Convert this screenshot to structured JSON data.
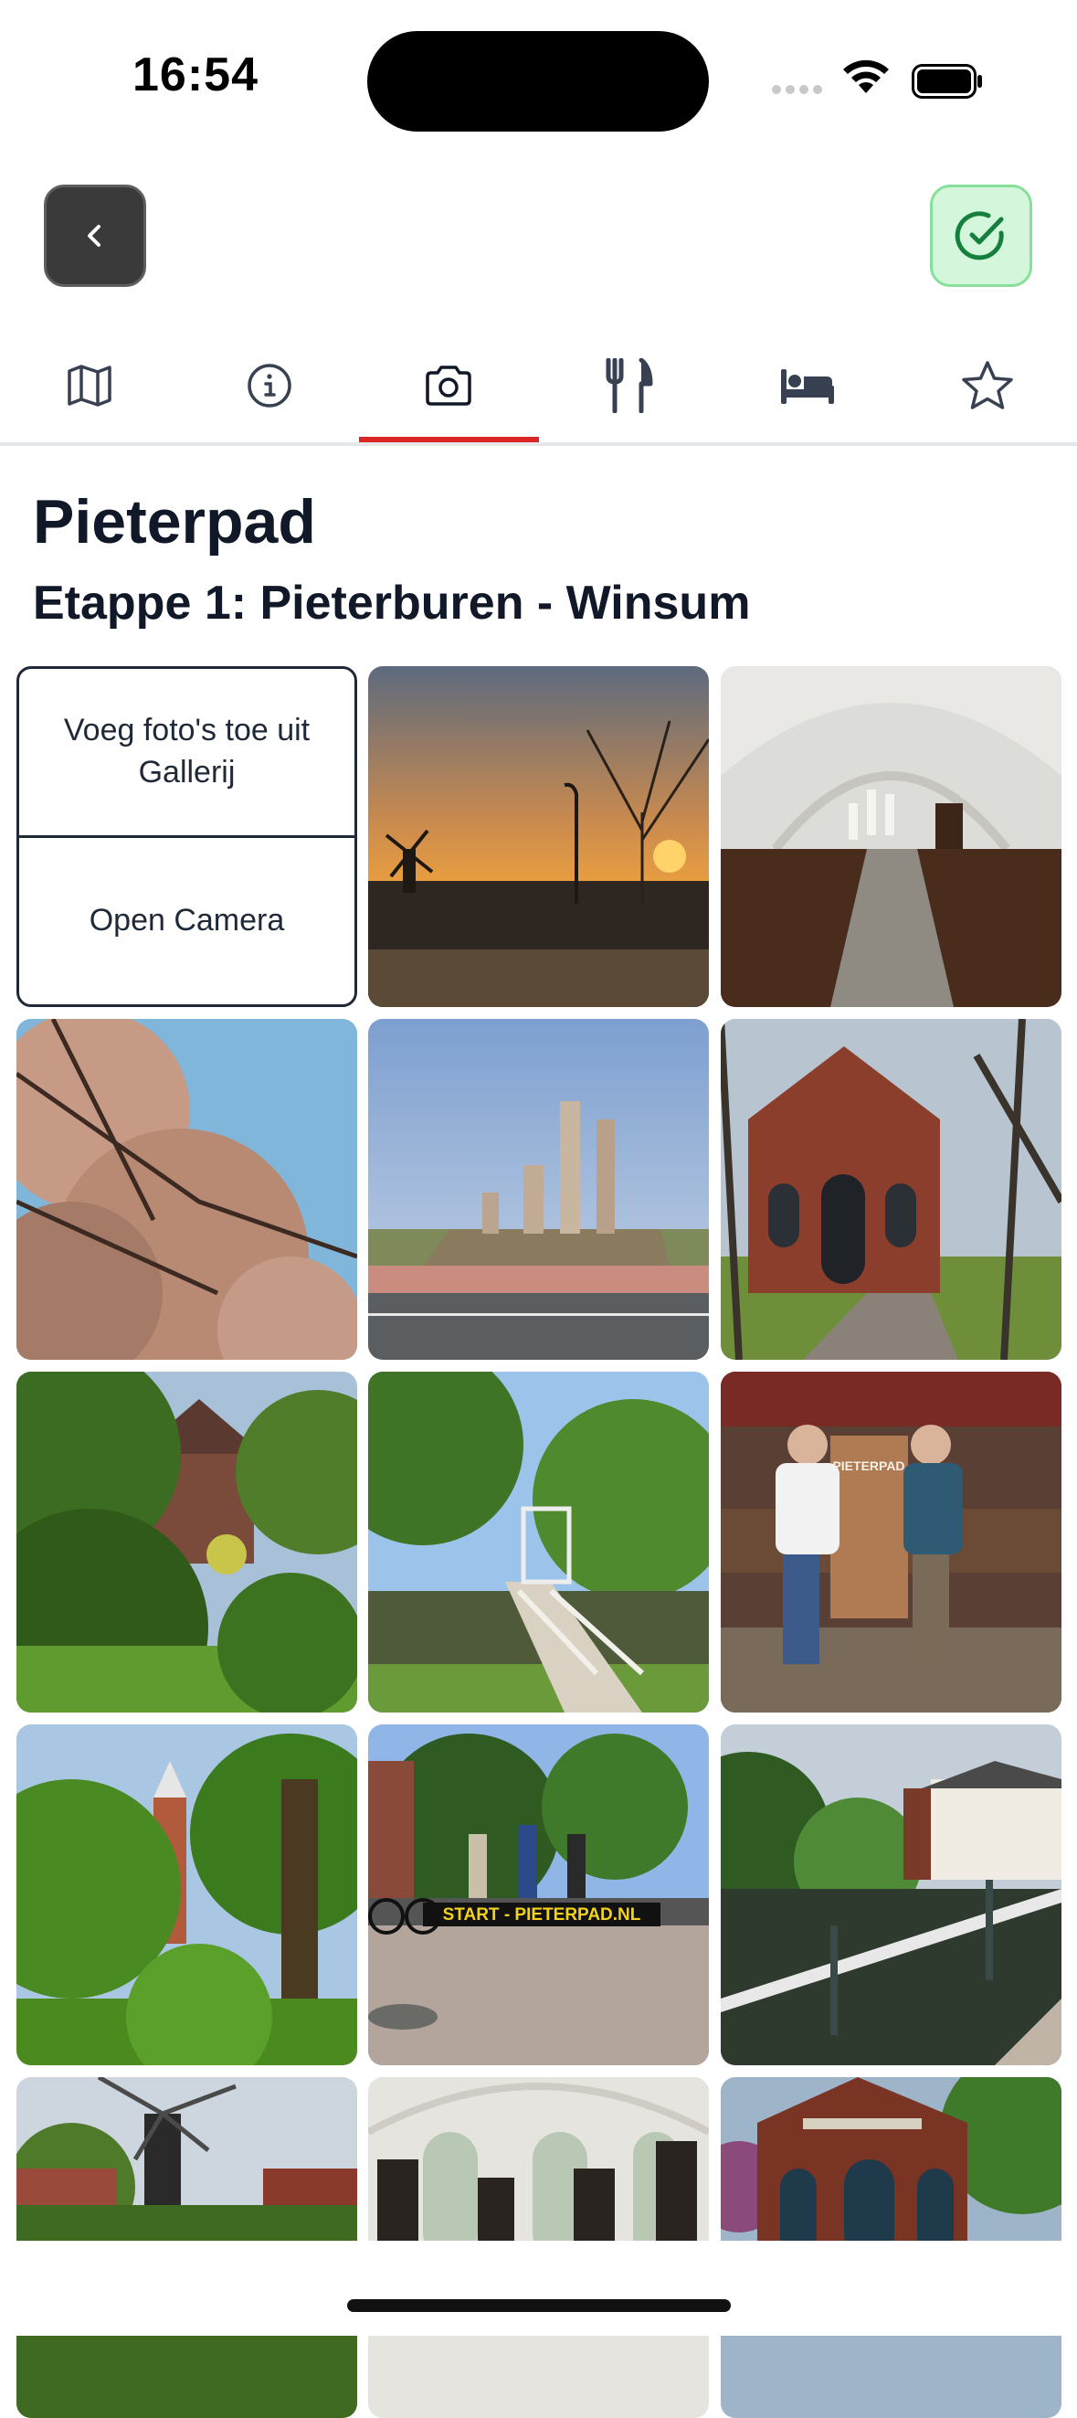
{
  "status_bar": {
    "time": "16:54"
  },
  "tabs": [
    {
      "name": "map-icon",
      "active": false
    },
    {
      "name": "info-icon",
      "active": false
    },
    {
      "name": "camera-icon",
      "active": true
    },
    {
      "name": "restaurant-icon",
      "active": false
    },
    {
      "name": "bed-icon",
      "active": false
    },
    {
      "name": "star-icon",
      "active": false
    }
  ],
  "page": {
    "title": "Pieterpad",
    "subtitle": "Etappe 1: Pieterburen - Winsum"
  },
  "add_tile": {
    "gallery_label": "Voeg foto's toe uit Gallerij",
    "camera_label": "Open Camera"
  },
  "photos": [
    {
      "name": "photo-sunset-windmill"
    },
    {
      "name": "photo-church-interior"
    },
    {
      "name": "photo-blossom-tree"
    },
    {
      "name": "photo-monument"
    },
    {
      "name": "photo-brick-chapel"
    },
    {
      "name": "photo-green-garden"
    },
    {
      "name": "photo-wooden-bridge"
    },
    {
      "name": "photo-hikers-signpost",
      "sign_text": "PIETERPAD"
    },
    {
      "name": "photo-church-tower-trees"
    },
    {
      "name": "photo-start-sign",
      "sign_text": "START - PIETERPAD.NL"
    },
    {
      "name": "photo-canal-railing"
    },
    {
      "name": "photo-windmill-village"
    },
    {
      "name": "photo-church-windows"
    },
    {
      "name": "photo-brick-house"
    }
  ],
  "colors": {
    "accent": "#dc2626",
    "success": "#16a34a"
  }
}
